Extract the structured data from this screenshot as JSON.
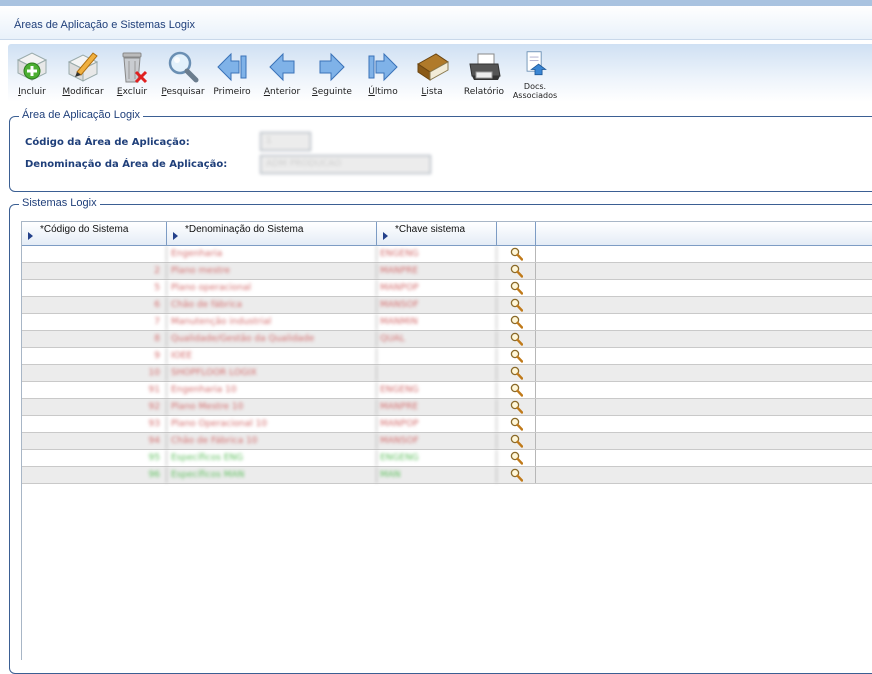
{
  "window": {
    "title": "Áreas de Aplicação e Sistemas Logix"
  },
  "toolbar": {
    "buttons": [
      {
        "id": "incluir",
        "label": "Incluir",
        "icon": "add-document-icon"
      },
      {
        "id": "modificar",
        "label": "Modificar",
        "icon": "edit-pencil-icon"
      },
      {
        "id": "excluir",
        "label": "Excluir",
        "icon": "trash-delete-icon"
      },
      {
        "id": "pesquisar",
        "label": "Pesquisar",
        "icon": "magnifier-search-icon"
      },
      {
        "id": "primeiro",
        "label": "Primeiro",
        "icon": "first-arrow-icon"
      },
      {
        "id": "anterior",
        "label": "Anterior",
        "icon": "previous-arrow-icon"
      },
      {
        "id": "seguinte",
        "label": "Seguinte",
        "icon": "next-arrow-icon"
      },
      {
        "id": "ultimo",
        "label": "Último",
        "icon": "last-arrow-icon"
      },
      {
        "id": "lista",
        "label": "Lista",
        "icon": "book-list-icon"
      },
      {
        "id": "relatorio",
        "label": "Relatório",
        "icon": "printer-report-icon"
      },
      {
        "id": "docs",
        "label": "Docs.",
        "label2": "Associados",
        "icon": "documents-upload-icon"
      }
    ]
  },
  "area": {
    "legend": "Área de Aplicação Logix",
    "codigo_label": "Código da Área de Aplicação:",
    "codigo_value": "1",
    "denominacao_label": "Denominação da Área de Aplicação:",
    "denominacao_value": "ADM PRODUCAO"
  },
  "sistemas": {
    "legend": "Sistemas Logix",
    "columns": [
      "*Código do Sistema",
      "*Denominação do Sistema",
      "*Chave sistema"
    ],
    "rows": [
      {
        "codigo": "",
        "denominacao": "Engenharia",
        "chave": "ENGENG",
        "color": "red"
      },
      {
        "codigo": "2",
        "denominacao": "Plano mestre",
        "chave": "MANPRE",
        "color": "red"
      },
      {
        "codigo": "5",
        "denominacao": "Plano operacional",
        "chave": "MANPOP",
        "color": "red"
      },
      {
        "codigo": "6",
        "denominacao": "Chão de fábrica",
        "chave": "MANSOF",
        "color": "red"
      },
      {
        "codigo": "7",
        "denominacao": "Manutenção industrial",
        "chave": "MANMIN",
        "color": "red"
      },
      {
        "codigo": "8",
        "denominacao": "Qualidade/Gestão da Qualidade",
        "chave": "QUAL",
        "color": "red"
      },
      {
        "codigo": "9",
        "denominacao": "IOEE",
        "chave": "",
        "color": "red"
      },
      {
        "codigo": "10",
        "denominacao": "SHOPFLOOR LOGIX",
        "chave": "",
        "color": "red"
      },
      {
        "codigo": "91",
        "denominacao": "Engenharia 10",
        "chave": "ENGENG",
        "color": "red"
      },
      {
        "codigo": "92",
        "denominacao": "Plano Mestre 10",
        "chave": "MANPRE",
        "color": "red"
      },
      {
        "codigo": "93",
        "denominacao": "Plano Operacional 10",
        "chave": "MANPOP",
        "color": "red"
      },
      {
        "codigo": "94",
        "denominacao": "Chão de Fábrica 10",
        "chave": "MANSOF",
        "color": "red"
      },
      {
        "codigo": "95",
        "denominacao": "Específicos ENG",
        "chave": "ENGENG",
        "color": "green"
      },
      {
        "codigo": "96",
        "denominacao": "Específicos MAN",
        "chave": "MAN",
        "color": "green"
      }
    ],
    "action_icon": "magnifier-icon"
  }
}
